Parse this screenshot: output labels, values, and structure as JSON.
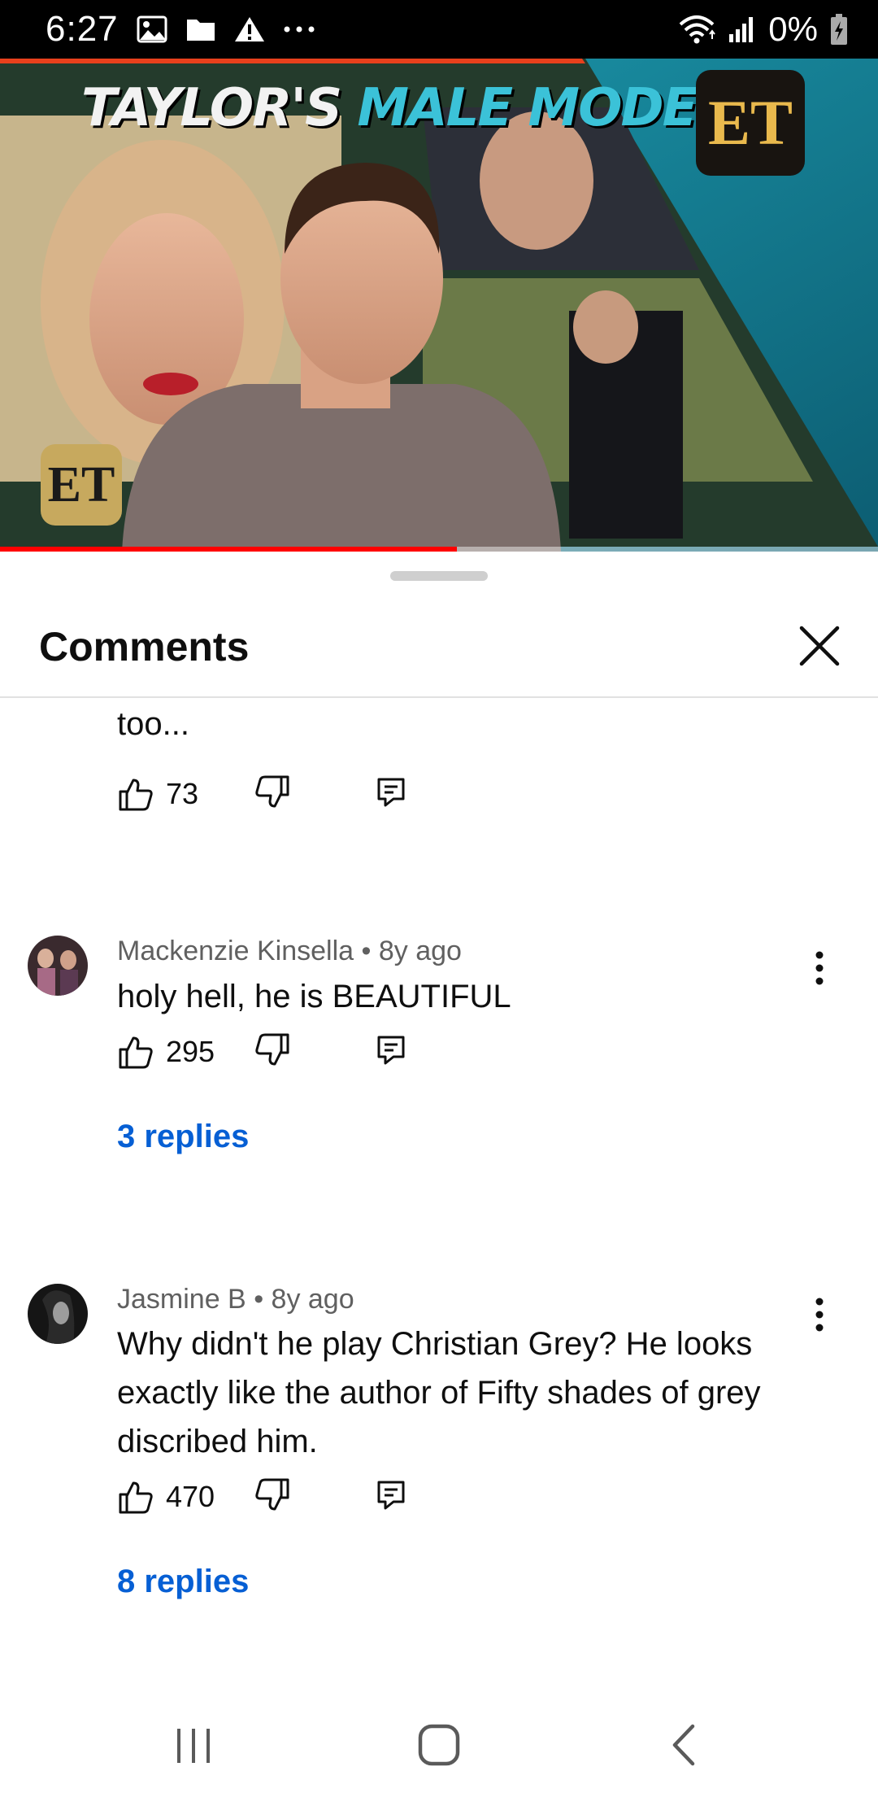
{
  "status_bar": {
    "time": "6:27",
    "battery": "0%",
    "icons": [
      "image-icon",
      "folder-icon",
      "warning-icon",
      "more-dots-icon",
      "wifi-icon",
      "signal-icon",
      "battery-charging-icon"
    ]
  },
  "video": {
    "title_part1": "TAYLOR'S ",
    "title_part2": "MALE MODEL",
    "logo_text": "ET",
    "progress_percent": 52
  },
  "comments_sheet": {
    "title": "Comments",
    "close_icon": "close-icon"
  },
  "comments": [
    {
      "text_tail": "too...",
      "likes": "73"
    },
    {
      "author": "Mackenzie Kinsella",
      "age": "8y ago",
      "text": "holy hell, he is BEAUTIFUL",
      "likes": "295",
      "replies": "3 replies"
    },
    {
      "author": "Jasmine B",
      "age": "8y ago",
      "text": "Why didn't he play Christian Grey? He looks exactly like the author of Fifty shades of grey discribed him.",
      "likes": "470",
      "replies": "8 replies"
    }
  ],
  "meta_separator": "•",
  "colors": {
    "link": "#065fd4",
    "progress": "#ff0000",
    "secondary_text": "#606060"
  }
}
